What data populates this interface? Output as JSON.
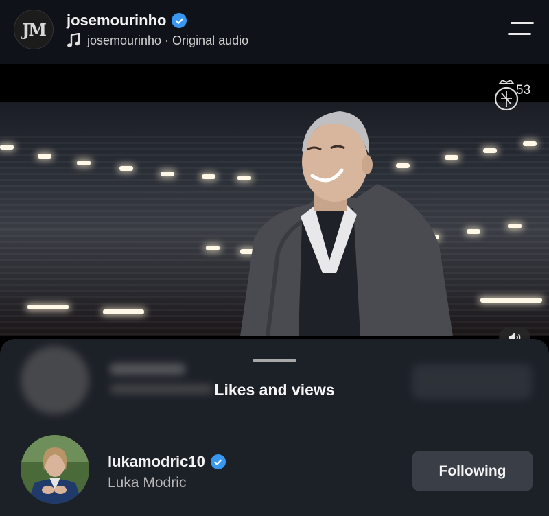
{
  "header": {
    "avatar_monogram": "JM",
    "username": "josemourinho",
    "audio_label": "josemourinho · Original audio"
  },
  "video": {
    "badge_count": "53"
  },
  "sheet": {
    "title": "Likes and views",
    "users": [
      {
        "username": "lukamodric10",
        "full_name": "Luka Modric",
        "button_label": "Following"
      }
    ]
  },
  "colors": {
    "verified": "#3897f0",
    "sheet_bg": "#1c2027",
    "button_bg": "#3a3f47"
  },
  "icons": [
    "menu-icon",
    "music-note-icon",
    "verified-icon",
    "speaker-muted-icon",
    "club-crest-icon"
  ]
}
